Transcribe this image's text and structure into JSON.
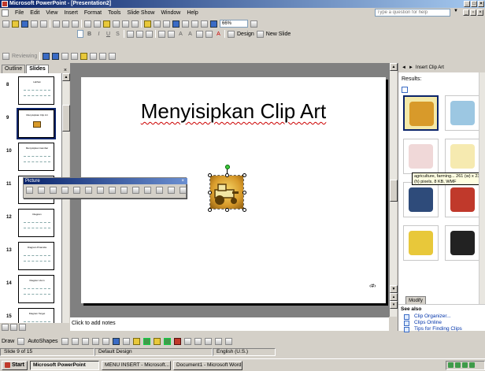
{
  "window": {
    "title": "Microsoft PowerPoint - [Presentation2]"
  },
  "menu": {
    "items": [
      "File",
      "Edit",
      "View",
      "Insert",
      "Format",
      "Tools",
      "Slide Show",
      "Window",
      "Help"
    ],
    "help_placeholder": "Type a question for help"
  },
  "toolbar": {
    "zoom": "66%",
    "design_label": "Design",
    "new_slide_label": "New Slide",
    "reviewing_label": "Reviewing"
  },
  "panes": {
    "tab_outline": "Outline",
    "tab_slides": "Slides",
    "close": "×"
  },
  "slides": [
    {
      "num": "8",
      "title": "Latihan"
    },
    {
      "num": "9",
      "title": "Menyisipkan Clip Art"
    },
    {
      "num": "10",
      "title": "Menyisipkan Gambar"
    },
    {
      "num": "11",
      "title": "Menyisipkan Diagram"
    },
    {
      "num": "12",
      "title": "Diagram"
    },
    {
      "num": "13",
      "title": "Diagram Piramida"
    },
    {
      "num": "14",
      "title": "Diagram Venn"
    },
    {
      "num": "15",
      "title": "Diagram Target"
    }
  ],
  "slide": {
    "title": "Menyisipkan Clip Art",
    "number_placeholder": "‹#›"
  },
  "picture_toolbar": {
    "title": "Picture",
    "close": "×"
  },
  "notes": {
    "placeholder": "Click to add notes"
  },
  "taskpane": {
    "title": "Insert Clip Art",
    "results_label": "Results:",
    "tooltip": "agriculture, farming... 261 (w) x 239 (h) pixels, 8 KB, WMF",
    "modify_label": "Modify",
    "see_also_label": "See also",
    "links": [
      "Clip Organizer...",
      "Clips Online",
      "Tips for Finding Clips"
    ]
  },
  "drawbar": {
    "draw_label": "Draw",
    "autoshapes_label": "AutoShapes"
  },
  "status": {
    "slide_counter": "Slide 9 of 15",
    "design": "Default Design",
    "language": "English (U.S.)"
  },
  "taskbar": {
    "start_label": "Start",
    "tasks": [
      "Microsoft PowerPoint",
      "MENU INSERT - Microsoft...",
      "Document1 - Microsoft Word"
    ]
  }
}
